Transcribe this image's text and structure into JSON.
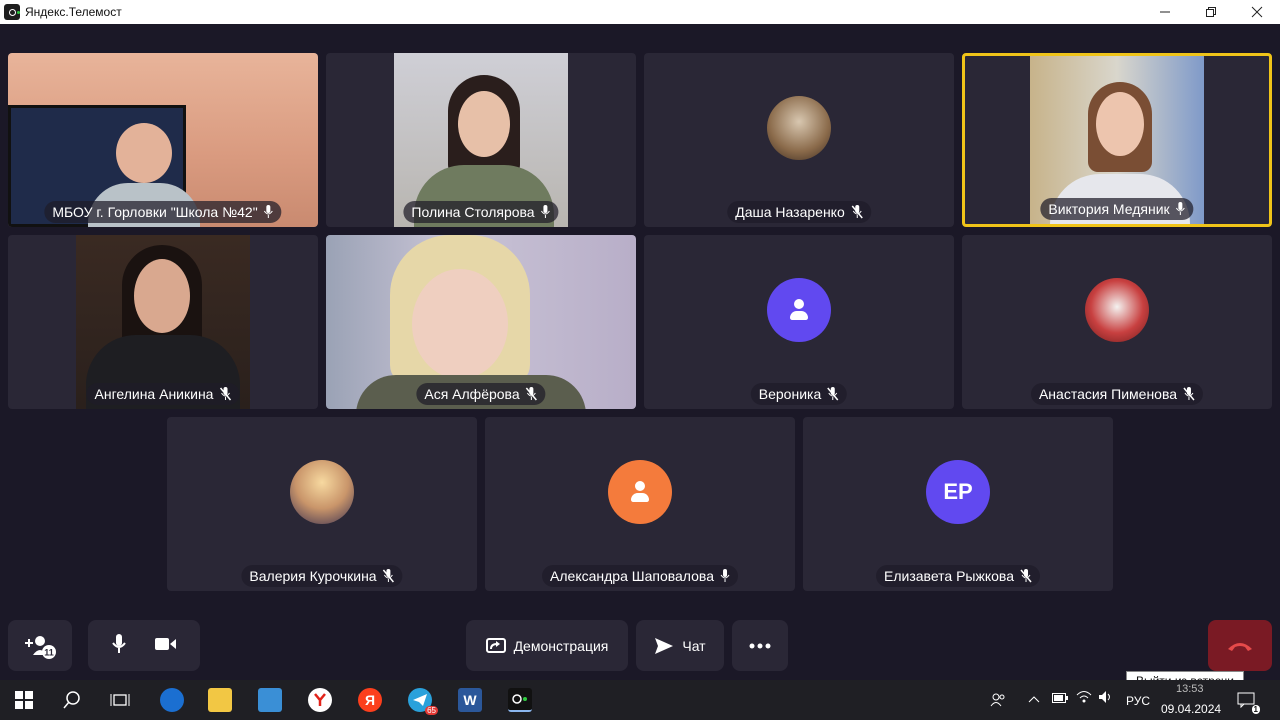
{
  "window": {
    "title": "Яндекс.Телемост"
  },
  "participants": [
    {
      "name": "МБОУ г. Горловки \"Школа №42\"",
      "mic": "on"
    },
    {
      "name": "Полина Столярова",
      "mic": "on"
    },
    {
      "name": "Даша Назаренко",
      "mic": "off"
    },
    {
      "name": "Виктория Медяник",
      "mic": "on",
      "active": true
    },
    {
      "name": "Ангелина Аникина",
      "mic": "off"
    },
    {
      "name": "Ася Алфёрова",
      "mic": "off"
    },
    {
      "name": "Вероника",
      "mic": "off"
    },
    {
      "name": "Анастасия Пименова",
      "mic": "off"
    },
    {
      "name": "Валерия Курочкина",
      "mic": "off"
    },
    {
      "name": "Александра Шаповалова",
      "mic": "on"
    },
    {
      "name": "Елизавета Рыжкова",
      "mic": "off",
      "initials": "ЕР"
    }
  ],
  "toolbar": {
    "participant_count": "11",
    "demo_label": "Демонстрация",
    "chat_label": "Чат",
    "leave_tooltip": "Выйти из встречи"
  },
  "taskbar": {
    "yandex_letter": "Я",
    "telegram_badge": "65",
    "word_letter": "W",
    "language": "РУС",
    "time": "13:53",
    "date": "09.04.2024",
    "notifications": "1"
  },
  "colors": {
    "active_border": "#f0c419",
    "end_call": "#7a1a24",
    "tile": "#2a2736",
    "background": "#1b1827"
  }
}
